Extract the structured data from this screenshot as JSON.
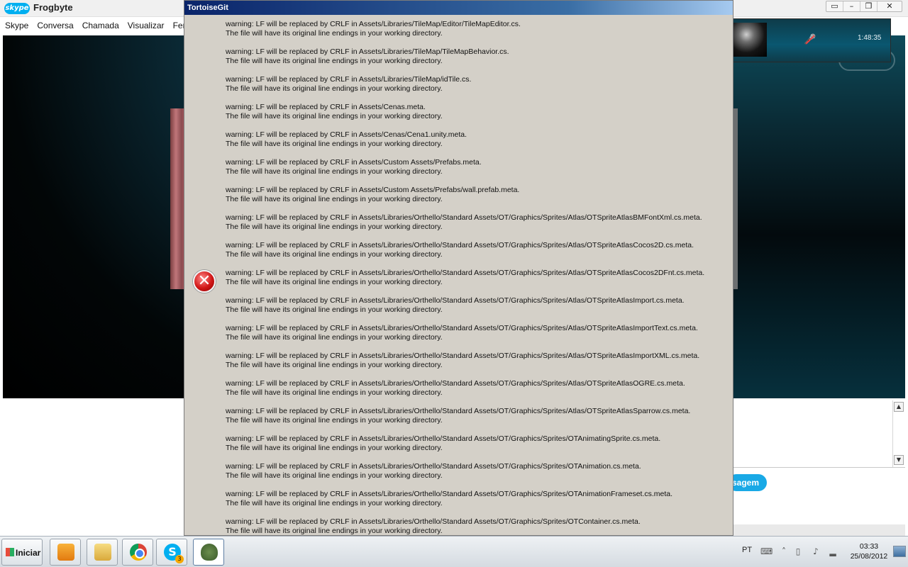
{
  "skype": {
    "logo": "skype",
    "title": "Frogbyte",
    "menu": [
      "Skype",
      "Conversa",
      "Chamada",
      "Visualizar",
      "Ferramentas"
    ],
    "window_controls": [
      "▭",
      "–",
      "❐",
      "✕"
    ],
    "call_time": "1:48:35",
    "send_label": "sagem"
  },
  "dialog": {
    "title": "TortoiseGit",
    "icon": "error-icon",
    "messages": [
      {
        "warning": "warning: LF will be replaced by CRLF in Assets/Libraries/TileMap/Editor/TileMapEditor.cs.",
        "note": "The file will have its original line endings in your working directory."
      },
      {
        "warning": "warning: LF will be replaced by CRLF in Assets/Libraries/TileMap/TileMapBehavior.cs.",
        "note": "The file will have its original line endings in your working directory."
      },
      {
        "warning": "warning: LF will be replaced by CRLF in Assets/Libraries/TileMap/idTile.cs.",
        "note": "The file will have its original line endings in your working directory."
      },
      {
        "warning": "warning: LF will be replaced by CRLF in Assets/Cenas.meta.",
        "note": "The file will have its original line endings in your working directory."
      },
      {
        "warning": "warning: LF will be replaced by CRLF in Assets/Cenas/Cena1.unity.meta.",
        "note": "The file will have its original line endings in your working directory."
      },
      {
        "warning": "warning: LF will be replaced by CRLF in Assets/Custom Assets/Prefabs.meta.",
        "note": "The file will have its original line endings in your working directory."
      },
      {
        "warning": "warning: LF will be replaced by CRLF in Assets/Custom Assets/Prefabs/wall.prefab.meta.",
        "note": "The file will have its original line endings in your working directory."
      },
      {
        "warning": "warning: LF will be replaced by CRLF in Assets/Libraries/Orthello/Standard Assets/OT/Graphics/Sprites/Atlas/OTSpriteAtlasBMFontXml.cs.meta.",
        "note": "The file will have its original line endings in your working directory."
      },
      {
        "warning": "warning: LF will be replaced by CRLF in Assets/Libraries/Orthello/Standard Assets/OT/Graphics/Sprites/Atlas/OTSpriteAtlasCocos2D.cs.meta.",
        "note": "The file will have its original line endings in your working directory."
      },
      {
        "warning": "warning: LF will be replaced by CRLF in Assets/Libraries/Orthello/Standard Assets/OT/Graphics/Sprites/Atlas/OTSpriteAtlasCocos2DFnt.cs.meta.",
        "note": "The file will have its original line endings in your working directory."
      },
      {
        "warning": "warning: LF will be replaced by CRLF in Assets/Libraries/Orthello/Standard Assets/OT/Graphics/Sprites/Atlas/OTSpriteAtlasImport.cs.meta.",
        "note": "The file will have its original line endings in your working directory."
      },
      {
        "warning": "warning: LF will be replaced by CRLF in Assets/Libraries/Orthello/Standard Assets/OT/Graphics/Sprites/Atlas/OTSpriteAtlasImportText.cs.meta.",
        "note": "The file will have its original line endings in your working directory."
      },
      {
        "warning": "warning: LF will be replaced by CRLF in Assets/Libraries/Orthello/Standard Assets/OT/Graphics/Sprites/Atlas/OTSpriteAtlasImportXML.cs.meta.",
        "note": "The file will have its original line endings in your working directory."
      },
      {
        "warning": "warning: LF will be replaced by CRLF in Assets/Libraries/Orthello/Standard Assets/OT/Graphics/Sprites/Atlas/OTSpriteAtlasOGRE.cs.meta.",
        "note": "The file will have its original line endings in your working directory."
      },
      {
        "warning": "warning: LF will be replaced by CRLF in Assets/Libraries/Orthello/Standard Assets/OT/Graphics/Sprites/Atlas/OTSpriteAtlasSparrow.cs.meta.",
        "note": "The file will have its original line endings in your working directory."
      },
      {
        "warning": "warning: LF will be replaced by CRLF in Assets/Libraries/Orthello/Standard Assets/OT/Graphics/Sprites/OTAnimatingSprite.cs.meta.",
        "note": "The file will have its original line endings in your working directory."
      },
      {
        "warning": "warning: LF will be replaced by CRLF in Assets/Libraries/Orthello/Standard Assets/OT/Graphics/Sprites/OTAnimation.cs.meta.",
        "note": "The file will have its original line endings in your working directory."
      },
      {
        "warning": "warning: LF will be replaced by CRLF in Assets/Libraries/Orthello/Standard Assets/OT/Graphics/Sprites/OTAnimationFrameset.cs.meta.",
        "note": "The file will have its original line endings in your working directory."
      },
      {
        "warning": "warning: LF will be replaced by CRLF in Assets/Libraries/Orthello/Standard Assets/OT/Graphics/Sprites/OTContainer.cs.meta.",
        "note": "The file will have its original line endings in your working directory."
      }
    ]
  },
  "taskbar": {
    "start_label": "Iniciar",
    "apps": [
      "media-player-icon",
      "explorer-icon",
      "chrome-icon",
      "skype-icon",
      "tortoisegit-icon"
    ],
    "skype_badge": "3",
    "language": "PT",
    "time": "03:33",
    "date": "25/08/2012"
  }
}
